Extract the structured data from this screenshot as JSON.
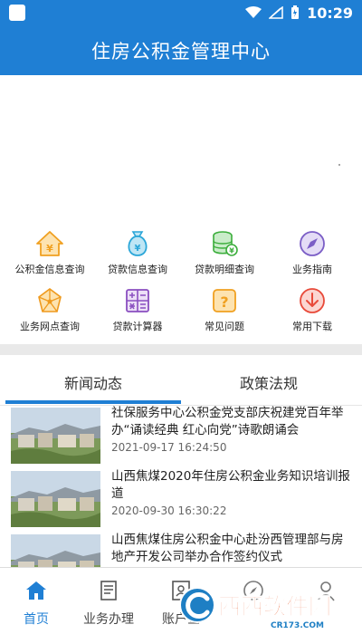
{
  "status_bar": {
    "time": "10:29"
  },
  "header": {
    "title": "住房公积金管理中心"
  },
  "grid": {
    "items": [
      {
        "label": "公积金信息查询",
        "icon": "house-coin-icon",
        "color": "#f0a020"
      },
      {
        "label": "贷款信息查询",
        "icon": "money-bag-icon",
        "color": "#2aa6d8"
      },
      {
        "label": "贷款明细查询",
        "icon": "money-stack-icon",
        "color": "#3cae3c"
      },
      {
        "label": "业务指南",
        "icon": "compass-icon",
        "color": "#7b5ec6"
      },
      {
        "label": "业务网点查询",
        "icon": "network-icon",
        "color": "#ef9a1e"
      },
      {
        "label": "贷款计算器",
        "icon": "calculator-icon",
        "color": "#8a4fc0"
      },
      {
        "label": "常见问题",
        "icon": "question-icon",
        "color": "#f0a020"
      },
      {
        "label": "常用下载",
        "icon": "download-icon",
        "color": "#e84a3a"
      }
    ]
  },
  "tabs": {
    "news": "新闻动态",
    "policy": "政策法规"
  },
  "news": [
    {
      "title": "社保服务中心公积金党支部庆祝建党百年举办“诵读经典 红心向党”诗歌朗诵会",
      "date": "2021-09-17 16:24:50"
    },
    {
      "title": "山西焦煤2020年住房公积金业务知识培训报道",
      "date": "2020-09-30 16:30:22"
    },
    {
      "title": "山西焦煤住房公积金中心赴汾西管理部与房地产开发公司举办合作签约仪式",
      "date": ""
    }
  ],
  "bottom_nav": {
    "home": "首页",
    "business": "业务办理",
    "account": "账户查"
  },
  "watermark": {
    "text": "西西软件园",
    "sub": "CR173.COM"
  },
  "colors": {
    "primary": "#1f7fd4"
  }
}
